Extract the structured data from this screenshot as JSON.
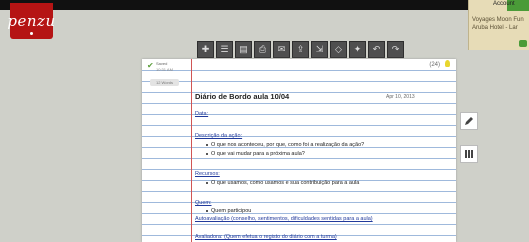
{
  "logo": {
    "text": "penzu"
  },
  "ad": {
    "account": "Account",
    "line1": "Voyages Moon Fun",
    "line2": "Aruba Hotel - Lar"
  },
  "toolbar": {
    "icons": [
      "new-entry-icon",
      "list-icon",
      "lock-icon",
      "print-icon",
      "email-icon",
      "share-icon",
      "export-icon",
      "tag-icon",
      "settings-icon",
      "undo-icon",
      "redo-icon"
    ]
  },
  "entry": {
    "saved": "Saved",
    "time": "10:31 AM",
    "meta_button": "12 Words",
    "word_count": "(24)",
    "title": "Diário de Bordo aula 10/04",
    "date": "Apr 10, 2013",
    "lines": [
      {
        "t": "Data:",
        "k": "h"
      },
      {
        "t": "Descrição da ação:",
        "k": "h"
      },
      {
        "t": "O que nos aconteceu, por que, como foi a realização da ação?",
        "k": "b"
      },
      {
        "t": "O que vai mudar para a próxima aula?",
        "k": "b"
      },
      {
        "t": "Recursos:",
        "k": "h"
      },
      {
        "t": "O que usamos, como usamos e sua contribuição para a aula",
        "k": "b"
      },
      {
        "t": "Quem:",
        "k": "h"
      },
      {
        "t": "Quem participou",
        "k": "b"
      },
      {
        "t": "Autoavaliação (conselho, sentimentos, dificuldades sentidas para a aula)",
        "k": "h"
      },
      {
        "t": "Avaliadora: (Quem efetua o registo do diário com a turma)",
        "k": "h"
      }
    ]
  },
  "side": {
    "pen": "pen-icon",
    "book": "book-icon"
  }
}
